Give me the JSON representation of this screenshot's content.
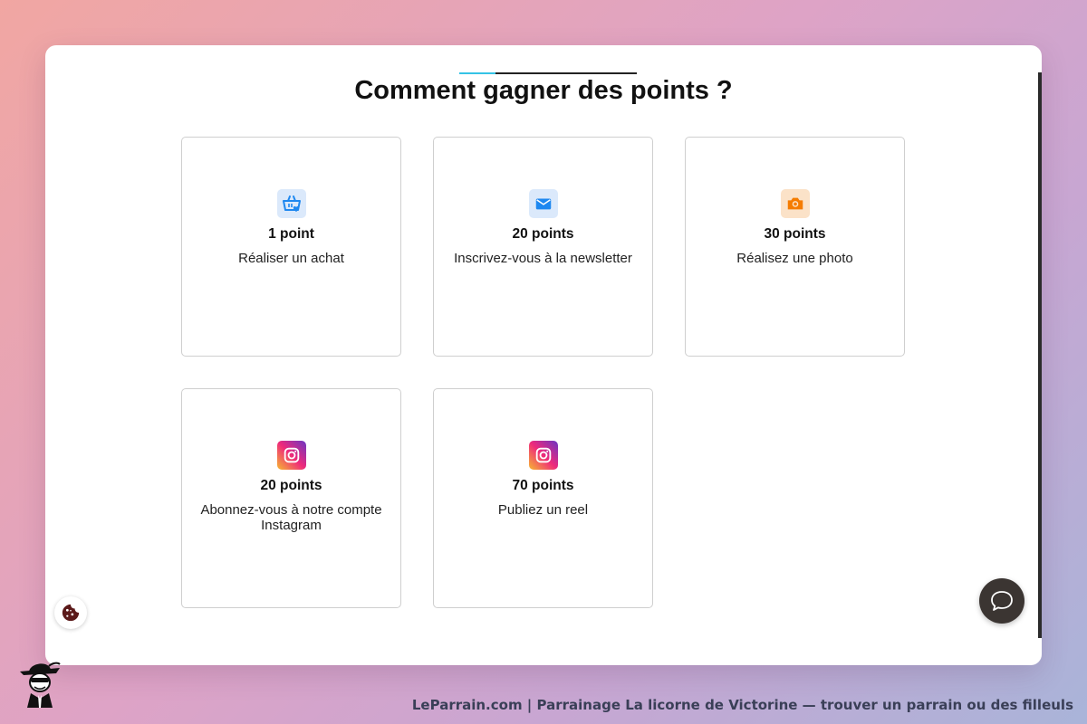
{
  "page": {
    "title": "Comment gagner des points ?"
  },
  "cards": [
    {
      "points": "1 point",
      "description": "Réaliser un achat",
      "icon": "basket-heart-icon"
    },
    {
      "points": "20 points",
      "description": "Inscrivez-vous à la newsletter",
      "icon": "envelope-icon"
    },
    {
      "points": "30 points",
      "description": "Réalisez une photo",
      "icon": "camera-icon"
    },
    {
      "points": "20 points",
      "description": "Abonnez-vous à notre compte Instagram",
      "icon": "instagram-icon"
    },
    {
      "points": "70 points",
      "description": "Publiez un reel",
      "icon": "instagram-icon"
    }
  ],
  "widgets": {
    "chat_icon": "chat-bubble-icon",
    "cookie_icon": "cookie-icon"
  },
  "footer": {
    "caption": "LeParrain.com | Parrainage La licorne de Victorine — trouver un parrain ou des filleuls"
  },
  "colors": {
    "accent_blue": "#1e88f0",
    "accent_orange": "#f57c00",
    "title_rule_accent": "#35c3e6",
    "chat_button": "#3b3532"
  }
}
